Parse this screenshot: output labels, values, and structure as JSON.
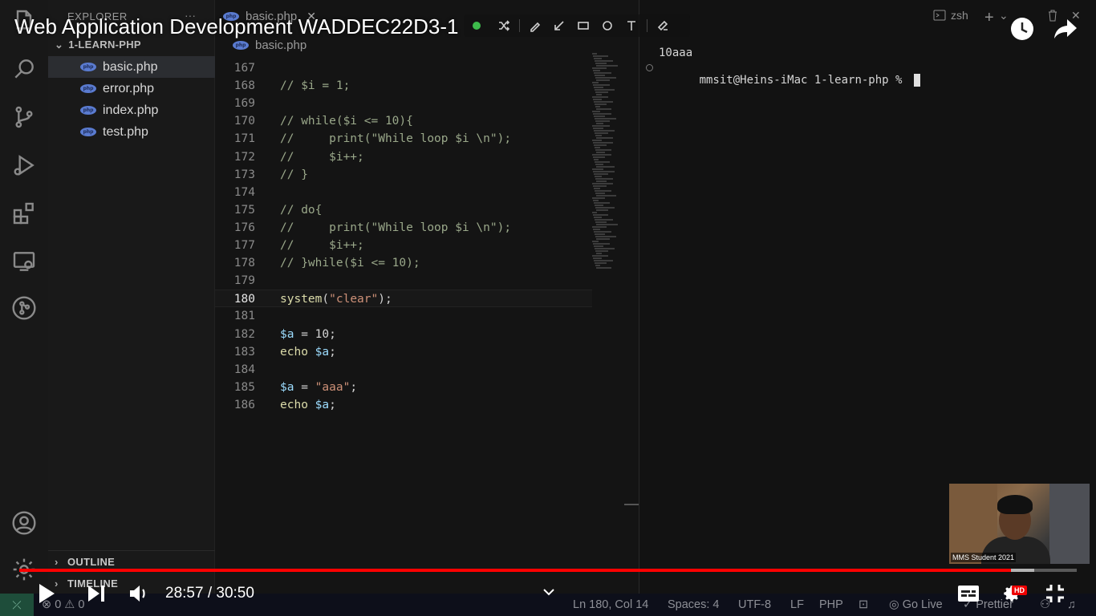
{
  "video": {
    "title": "Web Application Development WADDEC22D3-1",
    "time_current": "28:57",
    "time_separator": "/",
    "time_total": "30:50",
    "progress_played": 0.938,
    "progress_buffered": 0.96,
    "hd_badge": "HD",
    "webcam_label": "MMS Student 2021",
    "accent_color": "#ff0000"
  },
  "sidebar": {
    "header": "EXPLORER",
    "more": "···",
    "folder": "1-LEARN-PHP",
    "files": [
      {
        "name": "basic.php",
        "badge": "php"
      },
      {
        "name": "error.php",
        "badge": "php"
      },
      {
        "name": "index.php",
        "badge": "php"
      },
      {
        "name": "test.php",
        "badge": "php"
      }
    ],
    "outline": "OUTLINE",
    "timeline": "TIMELINE"
  },
  "editor": {
    "tab_label": "basic.php",
    "breadcrumb": "basic.php",
    "current_line": "180",
    "lines": [
      {
        "n": "167",
        "t": ""
      },
      {
        "n": "168",
        "t": "// $i = 1;"
      },
      {
        "n": "169",
        "t": ""
      },
      {
        "n": "170",
        "t": "// while($i <= 10){"
      },
      {
        "n": "171",
        "t": "//     print(\"While loop $i \\n\");"
      },
      {
        "n": "172",
        "t": "//     $i++;"
      },
      {
        "n": "173",
        "t": "// }"
      },
      {
        "n": "174",
        "t": ""
      },
      {
        "n": "175",
        "t": "// do{"
      },
      {
        "n": "176",
        "t": "//     print(\"While loop $i \\n\");"
      },
      {
        "n": "177",
        "t": "//     $i++;"
      },
      {
        "n": "178",
        "t": "// }while($i <= 10);"
      },
      {
        "n": "179",
        "t": ""
      },
      {
        "n": "180",
        "t": "system(\"clear\");"
      },
      {
        "n": "181",
        "t": ""
      },
      {
        "n": "182",
        "t": "$a = 10;"
      },
      {
        "n": "183",
        "t": "echo $a;"
      },
      {
        "n": "184",
        "t": ""
      },
      {
        "n": "185",
        "t": "$a = \"aaa\";"
      },
      {
        "n": "186",
        "t": "echo $a;"
      }
    ]
  },
  "terminal": {
    "shell": "zsh",
    "output": "10aaa",
    "prompt": "mmsit@Heins-iMac 1-learn-php % "
  },
  "statusbar": {
    "errors": "0",
    "warnings": "0",
    "position": "Ln 180, Col 14",
    "spaces": "Spaces: 4",
    "encoding": "UTF-8",
    "eol": "LF",
    "language": "PHP",
    "go_live": "Go Live",
    "prettier": "Prettier"
  }
}
